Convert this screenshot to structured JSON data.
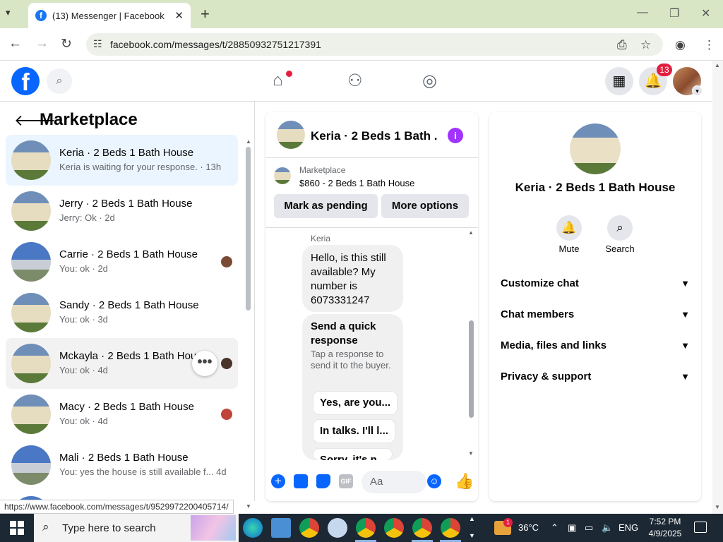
{
  "browser": {
    "tab_title": "(13) Messenger | Facebook",
    "tab_favicon": "f",
    "tab_close": "✕",
    "new_tab": "+",
    "url": "facebook.com/messages/t/28850932751217391",
    "status_url": "https://www.facebook.com/messages/t/9529972200405714/"
  },
  "fb_header": {
    "logo": "f",
    "notifications_count": "13"
  },
  "sidebar": {
    "title": "Marketplace",
    "conversations": [
      {
        "name": "Keria · 2 Beds 1 Bath House",
        "preview": "Keria is waiting for your response. · 13h"
      },
      {
        "name": "Jerry · 2 Beds 1 Bath House",
        "preview": "Jerry: Ok · 2d"
      },
      {
        "name": "Carrie · 2 Beds 1 Bath House",
        "preview": "You: ok · 2d"
      },
      {
        "name": "Sandy · 2 Beds 1 Bath House",
        "preview": "You: ok · 3d"
      },
      {
        "name": "Mckayla · 2 Beds 1 Bath House",
        "preview": "You: ok · 4d"
      },
      {
        "name": "Macy · 2 Beds 1 Bath House",
        "preview": "You: ok · 4d"
      },
      {
        "name": "Mali · 2 Beds 1 Bath House",
        "preview": "You: yes the house is still available f... 4d"
      }
    ],
    "more_dots": "•••"
  },
  "chat": {
    "title": "Keria · 2 Beds 1 Bath ...",
    "marketplace_label": "Marketplace",
    "listing": "$860 - 2 Beds 1 Bath House",
    "mark_pending": "Mark as pending",
    "more_options": "More options",
    "sender": "Keria",
    "message": "Hello, is this still available? My number is 6073331247",
    "quick_title": "Send a quick response",
    "quick_sub": "Tap a response to send it to the buyer.",
    "quick_responses": [
      "Yes, are you...",
      "In talks. I'll l...",
      "Sorry, it's n..."
    ],
    "input_placeholder": "Aa",
    "gif_label": "GIF"
  },
  "details": {
    "title": "Keria · 2 Beds 1 Bath House",
    "mute_label": "Mute",
    "search_label": "Search",
    "sections": [
      "Customize chat",
      "Chat members",
      "Media, files and links",
      "Privacy & support"
    ]
  },
  "taskbar": {
    "search_placeholder": "Type here to search",
    "weather": "36°C",
    "weather_badge": "1",
    "language": "ENG",
    "time": "7:52 PM",
    "date": "4/9/2025"
  },
  "colors": {
    "facebook_blue": "#0866ff",
    "selected_row": "#ebf5ff",
    "messenger_purple": "#a033ff",
    "badge_red": "#e41e3f"
  }
}
